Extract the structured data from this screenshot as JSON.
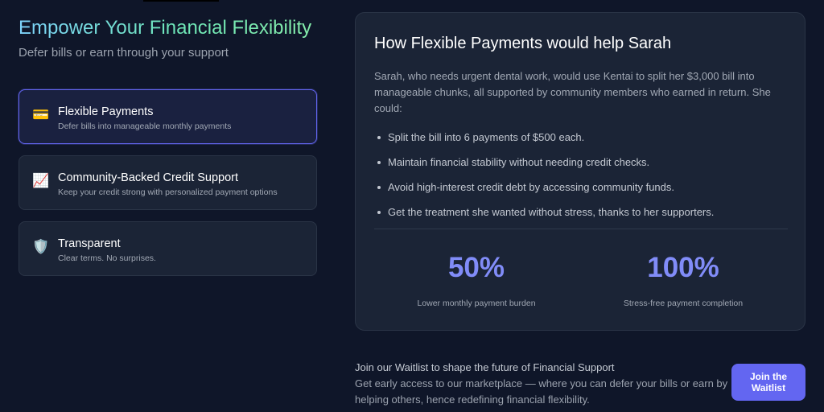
{
  "hero": {
    "title": "Empower Your Financial Flexibility",
    "subtitle": "Defer bills or earn through your support"
  },
  "features": [
    {
      "icon": "credit-card-icon",
      "glyph": "💳",
      "title": "Flexible Payments",
      "description": "Defer bills into manageable monthly payments",
      "active": true
    },
    {
      "icon": "chart-increasing-icon",
      "glyph": "📈",
      "title": "Community-Backed Credit Support",
      "description": "Keep your credit strong with personalized payment options",
      "active": false
    },
    {
      "icon": "shield-icon",
      "glyph": "🛡️",
      "title": "Transparent",
      "description": "Clear terms. No surprises.",
      "active": false
    }
  ],
  "detail": {
    "title": "How Flexible Payments would help Sarah",
    "intro": "Sarah, who needs urgent dental work, would use Kentai to split her $3,000 bill into manageable chunks, all supported by community members who earned in return. She could:",
    "bullets": [
      "Split the bill into 6 payments of $500 each.",
      "Maintain financial stability without needing credit checks.",
      "Avoid high-interest credit debt by accessing community funds.",
      "Get the treatment she wanted without stress, thanks to her supporters."
    ],
    "stats": [
      {
        "value": "50%",
        "label": "Lower monthly payment burden"
      },
      {
        "value": "100%",
        "label": "Stress-free payment completion"
      }
    ]
  },
  "waitlist": {
    "title": "Join our Waitlist to shape the future of Financial Support",
    "description": "Get early access to our marketplace — where you can defer your bills or earn by helping others, hence redefining financial flexibility.",
    "button_label": "Join the Waitlist"
  },
  "colors": {
    "background": "#0f1629",
    "card": "#1b2436",
    "accent": "#6366f1",
    "stat": "#818cf8"
  }
}
